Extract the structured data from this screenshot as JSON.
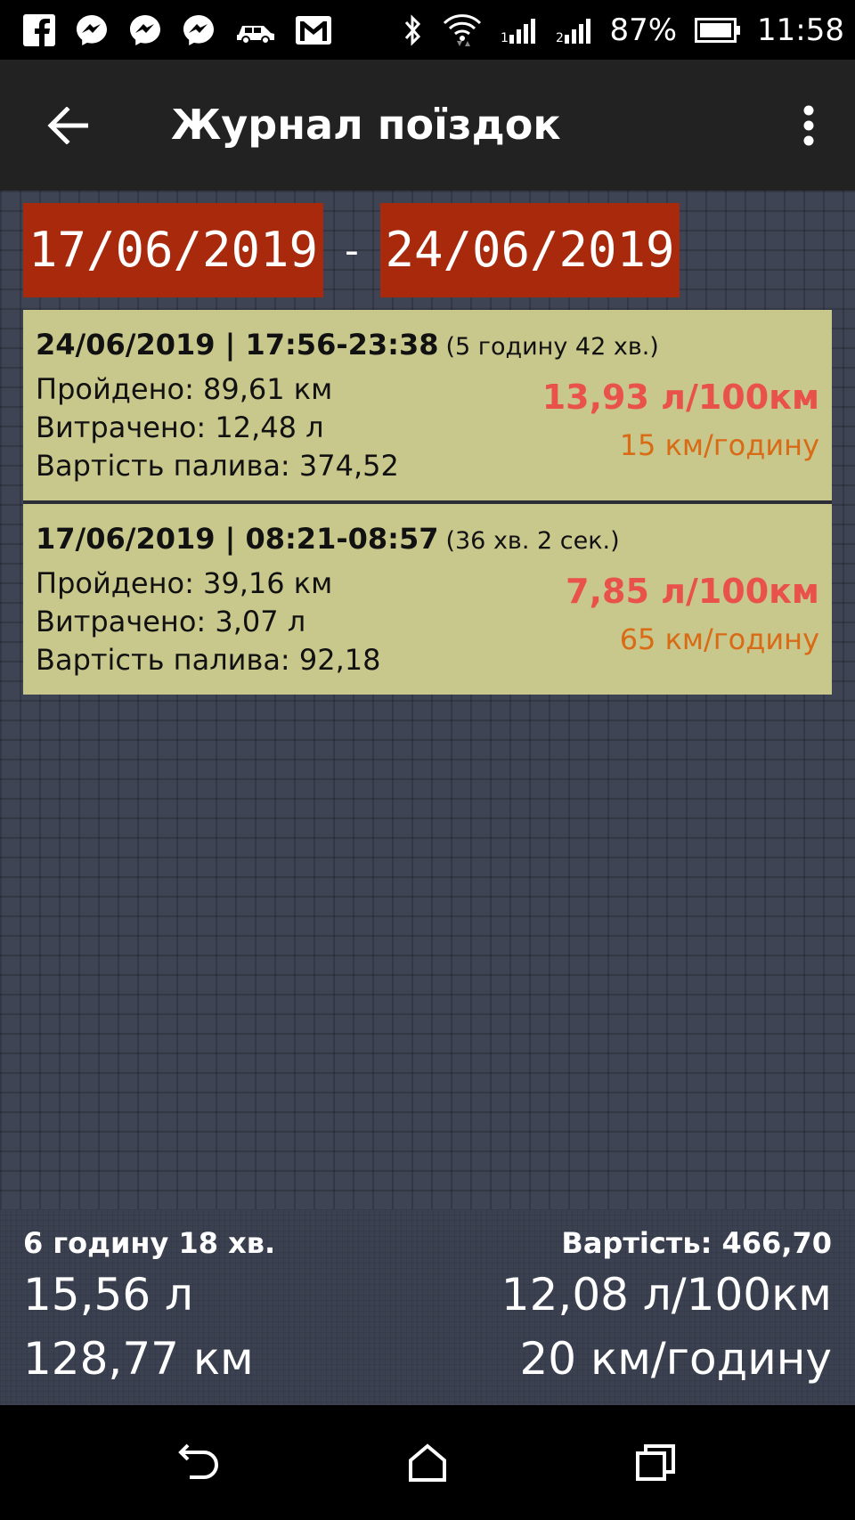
{
  "status_bar": {
    "icons_left": [
      "facebook-icon",
      "messenger-icon",
      "messenger-icon",
      "messenger-icon",
      "car-icon",
      "gmail-icon"
    ],
    "icons_right": [
      "bluetooth-icon",
      "wifi-icon",
      "signal-icon",
      "signal-icon",
      "battery-icon"
    ],
    "battery_percent": "87%",
    "time": "11:58"
  },
  "app_bar": {
    "title": "Журнал поїздок"
  },
  "date_range": {
    "from": "17/06/2019",
    "separator": "-",
    "to": "24/06/2019"
  },
  "trips": [
    {
      "header": "24/06/2019 | 17:56-23:38",
      "duration": "(5 годину 42 хв.)",
      "distance": "Пройдено: 89,61 км",
      "fuel": "Витрачено: 12,48 л",
      "cost": "Вартість палива: 374,52",
      "consumption": "13,93 л/100км",
      "speed": "15 км/годину"
    },
    {
      "header": "17/06/2019 | 08:21-08:57",
      "duration": "(36 хв. 2 сек.)",
      "distance": "Пройдено: 39,16 км",
      "fuel": "Витрачено: 3,07 л",
      "cost": "Вартість палива: 92,18",
      "consumption": "7,85 л/100км",
      "speed": "65 км/годину"
    }
  ],
  "summary": {
    "total_time": "6 годину 18 хв.",
    "total_fuel": "15,56 л",
    "total_distance": "128,77 км",
    "total_cost": "Вартість: 466,70",
    "avg_consumption": "12,08 л/100км",
    "avg_speed": "20 км/годину"
  },
  "colors": {
    "date_button": "#a8290b",
    "card_bg": "#c9c88c",
    "consumption_text": "#e8524a",
    "speed_text": "#d96a16",
    "background": "#3b4150"
  }
}
